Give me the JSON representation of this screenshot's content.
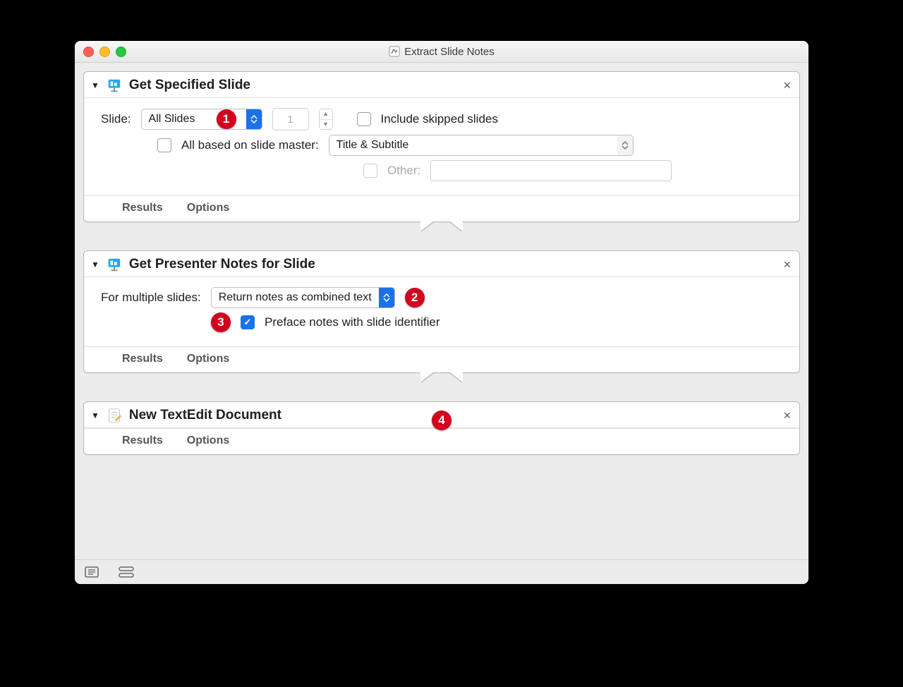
{
  "window": {
    "title": "Extract Slide Notes"
  },
  "callouts": {
    "c1": "1",
    "c2": "2",
    "c3": "3",
    "c4": "4"
  },
  "toolbar_terms": {
    "results": "Results",
    "options": "Options"
  },
  "action1": {
    "title": "Get Specified Slide",
    "slide_label": "Slide:",
    "slide_popup": "All Slides",
    "number_value": "1",
    "include_skipped": "Include skipped slides",
    "master_label": "All based on slide master:",
    "master_popup": "Title & Subtitle",
    "other_label": "Other:"
  },
  "action2": {
    "title": "Get Presenter Notes for Slide",
    "multi_label": "For multiple slides:",
    "multi_popup": "Return notes as combined text",
    "preface_label": "Preface notes with slide identifier"
  },
  "action3": {
    "title": "New TextEdit Document"
  }
}
